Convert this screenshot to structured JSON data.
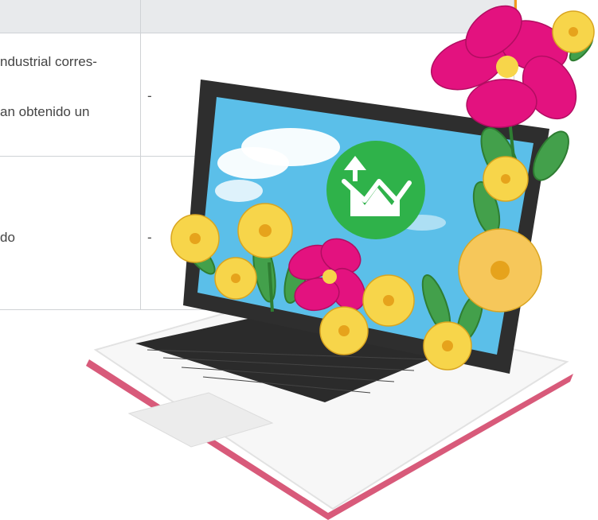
{
  "table": {
    "row1": {
      "text_line1": "ndustrial corres-",
      "text_line2": "an obtenido un",
      "value": "-"
    },
    "row2": {
      "text_line1": "do",
      "value": "-"
    }
  },
  "colors": {
    "accent_orange": "#f39a1e",
    "header_bg": "#e8eaec",
    "screen_sky": "#5bbfe9",
    "logo_green": "#2fb24a",
    "pink_flower": "#e3127f",
    "yellow_flower": "#f7d54a"
  },
  "illustration": {
    "icon": "trending-chart-icon"
  }
}
